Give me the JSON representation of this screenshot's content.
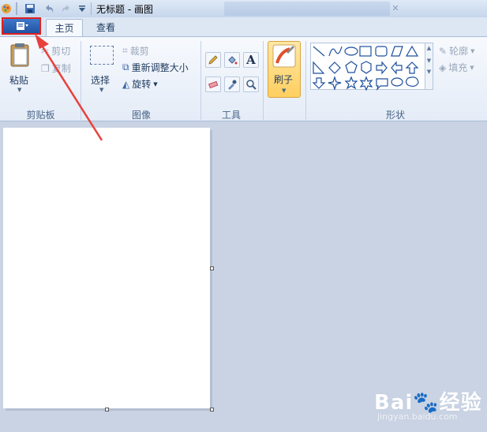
{
  "window": {
    "title": "无标题 - 画图"
  },
  "tabs": [
    {
      "label": "主页",
      "active": true
    },
    {
      "label": "查看",
      "active": false
    }
  ],
  "clipboard": {
    "paste_label": "粘贴",
    "cut_label": "剪切",
    "copy_label": "复制",
    "group_label": "剪贴板"
  },
  "image": {
    "select_label": "选择",
    "crop_label": "裁剪",
    "resize_label": "重新调整大小",
    "rotate_label": "旋转",
    "group_label": "图像"
  },
  "tools": {
    "group_label": "工具",
    "items": [
      "pencil-icon",
      "fill-icon",
      "text-icon",
      "eraser-icon",
      "color-picker-icon",
      "magnifier-icon"
    ]
  },
  "brushes": {
    "label": "刷子"
  },
  "shapes": {
    "group_label": "形状",
    "outline_label": "轮廓",
    "fill_label": "填充"
  },
  "watermark": {
    "brand": "Bai🐾经验",
    "url": "jingyan.baidu.com"
  },
  "colors": {
    "highlight": "#e02020",
    "arrow": "#e8413b",
    "brush_active": "#ffcf60"
  }
}
